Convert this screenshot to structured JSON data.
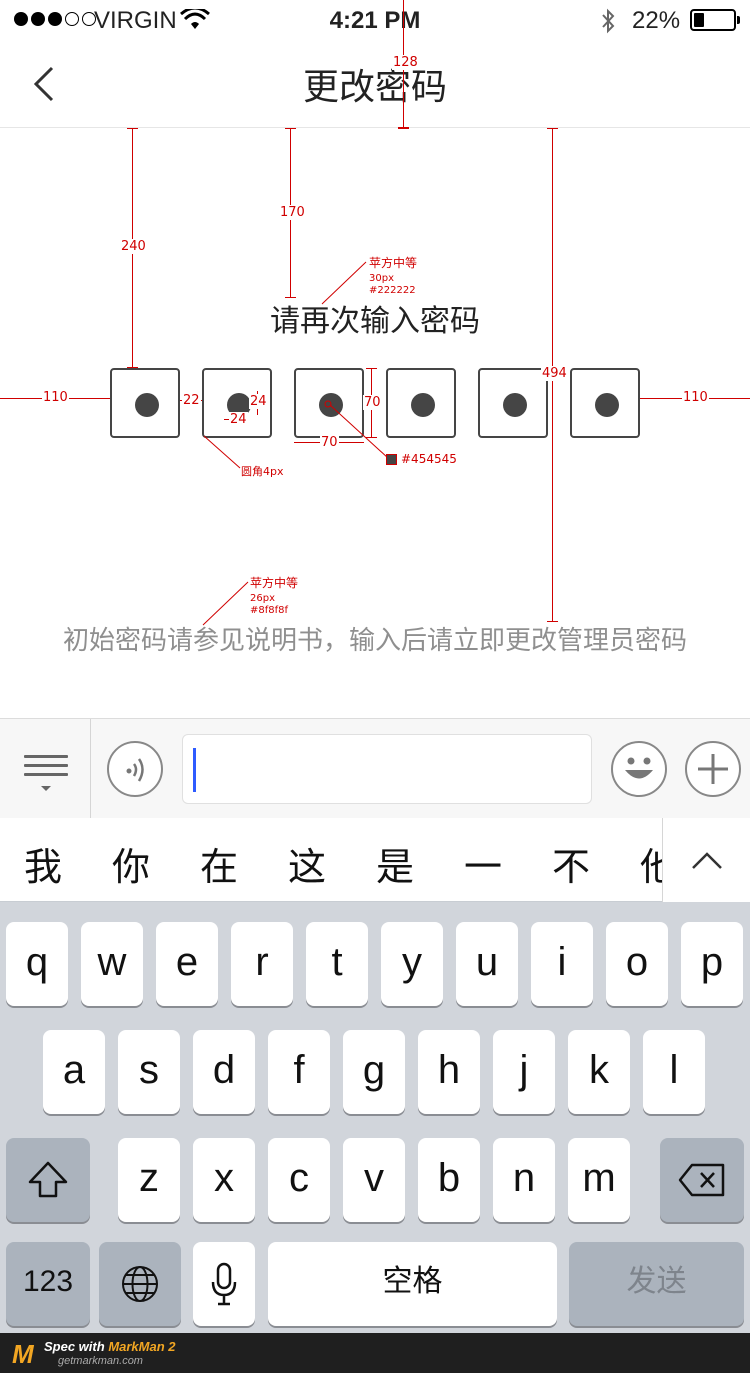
{
  "status_bar": {
    "carrier": "VIRGIN",
    "time": "4:21 PM",
    "battery_percent": "22%",
    "battery_level": 0.22,
    "signal_bars_filled": 3,
    "signal_bars_total": 5
  },
  "nav": {
    "title": "更改密码",
    "back_icon": "chevron-left-icon"
  },
  "content": {
    "prompt": "请再次输入密码",
    "hint": "初始密码请参见说明书，输入后请立即更改管理员密码",
    "pin_length": 6,
    "filled_count": 6,
    "colors": {
      "prompt": "#222222",
      "hint": "#8f8f8f",
      "pin_dot": "#454545",
      "box_border": "#454545"
    }
  },
  "annotations": {
    "dims": {
      "nav_height": "128",
      "top_to_boxes": "240",
      "top_to_prompt": "170",
      "top_to_hint": "494",
      "margin_left": "110",
      "margin_right": "110",
      "gap": "22",
      "box_size_h": "70",
      "box_size_w": "70",
      "dot_w": "24",
      "dot_h": "24"
    },
    "prompt_spec": {
      "font": "苹方中等",
      "size": "30px",
      "color": "#222222"
    },
    "hint_spec": {
      "font": "苹方中等",
      "size": "26px",
      "color": "#8f8f8f"
    },
    "corner_radius": "圆角4px",
    "dot_color": "#454545"
  },
  "input_bar": {
    "menu_icon": "list-menu-icon",
    "voice_icon": "voice-wave-icon",
    "emoji_icon": "smiley-icon",
    "add_icon": "plus-icon"
  },
  "candidates": {
    "items": [
      "我",
      "你",
      "在",
      "这",
      "是",
      "一",
      "不",
      "他"
    ],
    "expand_icon": "chevron-up-icon"
  },
  "keyboard": {
    "row1": [
      "q",
      "w",
      "e",
      "r",
      "t",
      "y",
      "u",
      "i",
      "o",
      "p"
    ],
    "row2": [
      "a",
      "s",
      "d",
      "f",
      "g",
      "h",
      "j",
      "k",
      "l"
    ],
    "row3": [
      "z",
      "x",
      "c",
      "v",
      "b",
      "n",
      "m"
    ],
    "shift_icon": "shift-icon",
    "delete_icon": "backspace-icon",
    "numbers_label": "123",
    "globe_icon": "globe-icon",
    "mic_icon": "microphone-icon",
    "space_label": "空格",
    "send_label": "发送"
  },
  "footer": {
    "spec_label": "Spec with",
    "brand": "MarkMan 2",
    "url": "getmarkman.com"
  }
}
